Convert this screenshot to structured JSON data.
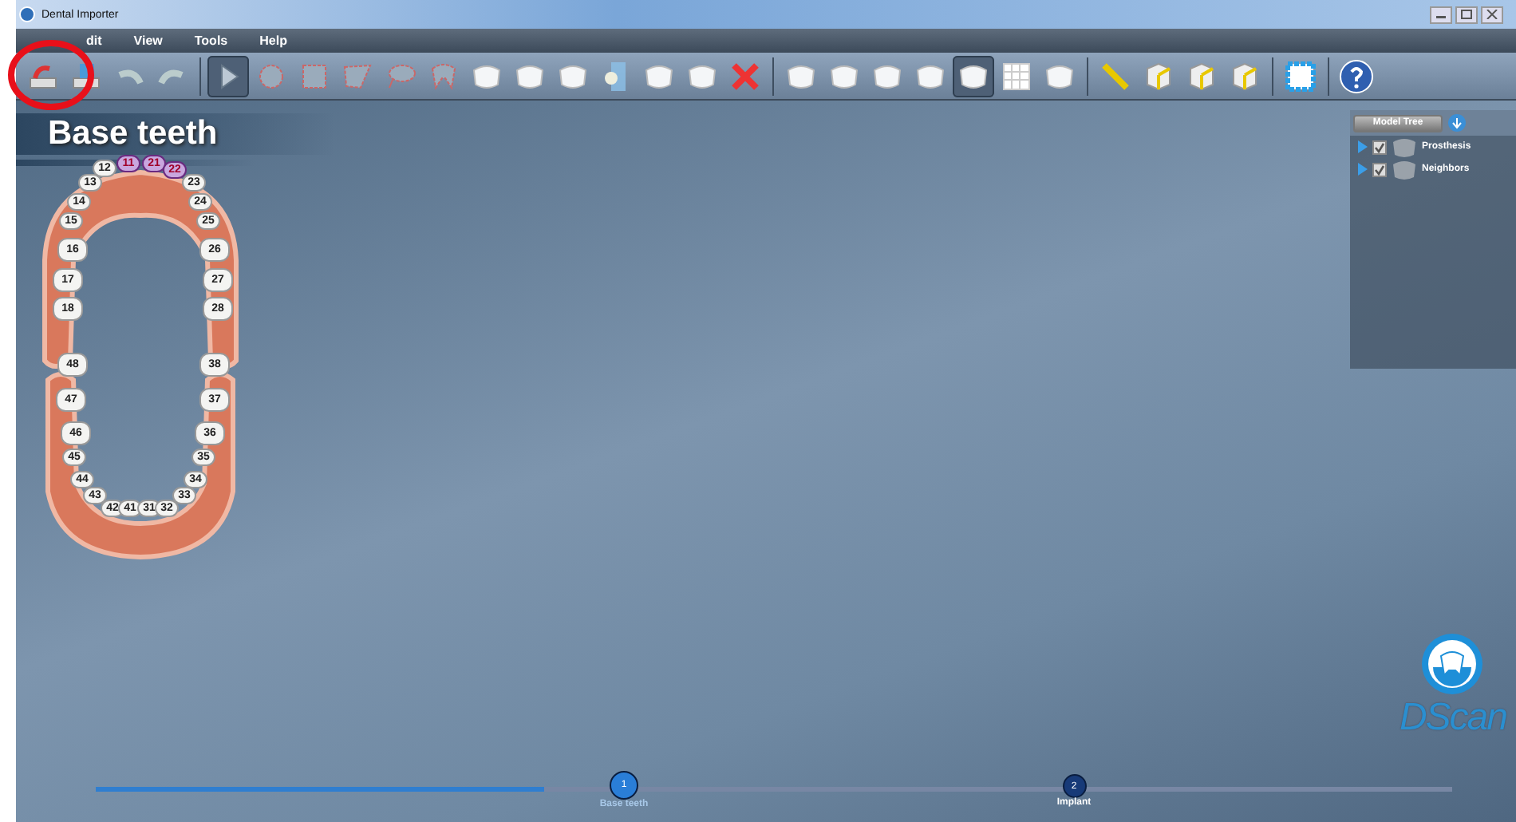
{
  "window": {
    "title": "Dental Importer"
  },
  "menu": [
    "dit",
    "View",
    "Tools",
    "Help"
  ],
  "toolbar": [
    [
      {
        "kind": "import",
        "selected": false
      },
      {
        "kind": "export",
        "selected": false
      },
      {
        "kind": "undo",
        "selected": false
      },
      {
        "kind": "redo",
        "selected": false
      }
    ],
    [
      {
        "kind": "arrow",
        "selected": true
      },
      {
        "kind": "circle",
        "selected": false
      },
      {
        "kind": "square",
        "selected": false
      },
      {
        "kind": "poly",
        "selected": false
      },
      {
        "kind": "lasso",
        "selected": false
      },
      {
        "kind": "toothoutline",
        "selected": false
      },
      {
        "kind": "tooth",
        "selected": false
      },
      {
        "kind": "tooth",
        "selected": false
      },
      {
        "kind": "tooth",
        "selected": false
      },
      {
        "kind": "plane",
        "selected": false
      },
      {
        "kind": "tooth",
        "selected": false
      },
      {
        "kind": "tooth",
        "selected": false
      },
      {
        "kind": "delete",
        "selected": false
      }
    ],
    [
      {
        "kind": "tooth",
        "selected": false
      },
      {
        "kind": "tooth",
        "selected": false
      },
      {
        "kind": "tooth",
        "selected": false
      },
      {
        "kind": "tooth",
        "selected": false
      },
      {
        "kind": "tooth",
        "selected": true
      },
      {
        "kind": "grid",
        "selected": false
      },
      {
        "kind": "tooth",
        "selected": false
      }
    ],
    [
      {
        "kind": "ruler",
        "selected": false
      },
      {
        "kind": "cube",
        "selected": false
      },
      {
        "kind": "cube",
        "selected": false
      },
      {
        "kind": "cube",
        "selected": false
      }
    ],
    [
      {
        "kind": "frame",
        "selected": false
      }
    ],
    [
      {
        "kind": "help",
        "selected": false
      }
    ]
  ],
  "heading": "Base teeth",
  "teeth": [
    {
      "label": "11",
      "selected": true
    },
    {
      "label": "21",
      "selected": true
    },
    {
      "label": "12",
      "selected": false
    },
    {
      "label": "22",
      "selected": true
    },
    {
      "label": "13",
      "selected": false
    },
    {
      "label": "23",
      "selected": false
    },
    {
      "label": "14",
      "selected": false
    },
    {
      "label": "24",
      "selected": false
    },
    {
      "label": "15",
      "selected": false
    },
    {
      "label": "25",
      "selected": false
    },
    {
      "label": "16",
      "selected": false
    },
    {
      "label": "26",
      "selected": false
    },
    {
      "label": "17",
      "selected": false
    },
    {
      "label": "27",
      "selected": false
    },
    {
      "label": "18",
      "selected": false
    },
    {
      "label": "28",
      "selected": false
    },
    {
      "label": "48",
      "selected": false
    },
    {
      "label": "38",
      "selected": false
    },
    {
      "label": "47",
      "selected": false
    },
    {
      "label": "37",
      "selected": false
    },
    {
      "label": "46",
      "selected": false
    },
    {
      "label": "36",
      "selected": false
    },
    {
      "label": "45",
      "selected": false
    },
    {
      "label": "35",
      "selected": false
    },
    {
      "label": "44",
      "selected": false
    },
    {
      "label": "34",
      "selected": false
    },
    {
      "label": "43",
      "selected": false
    },
    {
      "label": "33",
      "selected": false
    },
    {
      "label": "42",
      "selected": false
    },
    {
      "label": "41",
      "selected": false
    },
    {
      "label": "31",
      "selected": false
    },
    {
      "label": "32",
      "selected": false
    }
  ],
  "model_tree": {
    "button": "Model Tree",
    "items": [
      {
        "label": "Prosthesis",
        "checked": true,
        "expanded": false
      },
      {
        "label": "Neighbors",
        "checked": true,
        "expanded": false
      }
    ]
  },
  "logo": "DScan",
  "steps": {
    "level": 0.33,
    "items": [
      {
        "number": "1",
        "label": "Base teeth",
        "selected": true
      },
      {
        "number": "2",
        "label": "Implant",
        "selected": false
      }
    ]
  }
}
